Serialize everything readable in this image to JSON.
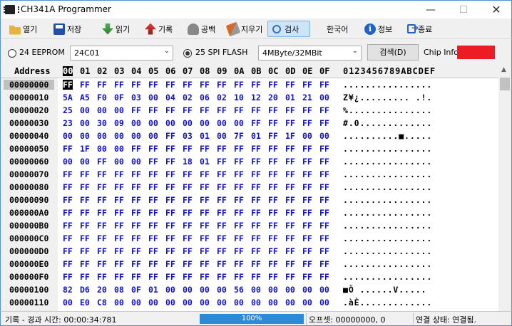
{
  "window": {
    "title": "CH341A Programmer",
    "min": "—",
    "max": "☐",
    "close": "✕"
  },
  "toolbar": [
    {
      "id": "open",
      "label": "열기",
      "icon": "folder-icon"
    },
    {
      "id": "save",
      "label": "저장",
      "icon": "save-icon"
    },
    {
      "id": "read",
      "label": "읽기",
      "icon": "read-icon"
    },
    {
      "id": "write",
      "label": "기록",
      "icon": "write-icon"
    },
    {
      "id": "blank",
      "label": "공백",
      "icon": "blank-check-icon"
    },
    {
      "id": "erase",
      "label": "지우기",
      "icon": "erase-icon"
    },
    {
      "id": "verify",
      "label": "검사",
      "icon": "verify-icon"
    },
    {
      "id": "lang",
      "label": "한국어",
      "icon": ""
    },
    {
      "id": "info",
      "label": "정보",
      "icon": "info-icon"
    },
    {
      "id": "exit",
      "label": "종료",
      "icon": "exit-icon"
    }
  ],
  "chip": {
    "eeprom_label": "24 EEPROM",
    "eeprom_model": "24C01",
    "spi_label": "25 SPI FLASH",
    "spi_selected": true,
    "spi_size": "4MByte/32MBit",
    "detect_label": "검색(D)",
    "chip_info_label": "Chip Info:",
    "chip_info_color": "#ed1c24"
  },
  "hex": {
    "address_header": "Address",
    "columns": [
      "00",
      "01",
      "02",
      "03",
      "04",
      "05",
      "06",
      "07",
      "08",
      "09",
      "0A",
      "0B",
      "0C",
      "0D",
      "0E",
      "0F"
    ],
    "ascii_header": "0123456789ABCDEF",
    "rows": [
      {
        "addr": "00000000",
        "bytes": [
          "FF",
          "FF",
          "FF",
          "FF",
          "FF",
          "FF",
          "FF",
          "FF",
          "FF",
          "FF",
          "FF",
          "FF",
          "FF",
          "FF",
          "FF",
          "FF"
        ],
        "ascii": "................"
      },
      {
        "addr": "00000010",
        "bytes": [
          "5A",
          "A5",
          "F0",
          "0F",
          "03",
          "00",
          "04",
          "02",
          "06",
          "02",
          "10",
          "12",
          "20",
          "01",
          "21",
          "00"
        ],
        "ascii": "Z¥¿......... .!."
      },
      {
        "addr": "00000020",
        "bytes": [
          "25",
          "00",
          "00",
          "00",
          "FF",
          "FF",
          "FF",
          "FF",
          "FF",
          "FF",
          "FF",
          "FF",
          "FF",
          "FF",
          "FF",
          "FF"
        ],
        "ascii": "%..............."
      },
      {
        "addr": "00000030",
        "bytes": [
          "23",
          "00",
          "30",
          "09",
          "00",
          "00",
          "00",
          "00",
          "00",
          "00",
          "00",
          "FF",
          "FF",
          "FF",
          "FF",
          "FF"
        ],
        "ascii": "#.0............."
      },
      {
        "addr": "00000040",
        "bytes": [
          "00",
          "00",
          "00",
          "00",
          "00",
          "00",
          "FF",
          "03",
          "01",
          "00",
          "7F",
          "01",
          "FF",
          "1F",
          "00",
          "00"
        ],
        "ascii": "..........■....."
      },
      {
        "addr": "00000050",
        "bytes": [
          "FF",
          "1F",
          "00",
          "00",
          "FF",
          "FF",
          "FF",
          "FF",
          "FF",
          "FF",
          "FF",
          "FF",
          "FF",
          "FF",
          "FF",
          "FF"
        ],
        "ascii": "................"
      },
      {
        "addr": "00000060",
        "bytes": [
          "00",
          "00",
          "FF",
          "00",
          "00",
          "FF",
          "FF",
          "18",
          "01",
          "FF",
          "FF",
          "FF",
          "FF",
          "FF",
          "FF",
          "FF"
        ],
        "ascii": "................"
      },
      {
        "addr": "00000070",
        "bytes": [
          "FF",
          "FF",
          "FF",
          "FF",
          "FF",
          "FF",
          "FF",
          "FF",
          "FF",
          "FF",
          "FF",
          "FF",
          "FF",
          "FF",
          "FF",
          "FF"
        ],
        "ascii": "................"
      },
      {
        "addr": "00000080",
        "bytes": [
          "FF",
          "FF",
          "FF",
          "FF",
          "FF",
          "FF",
          "FF",
          "FF",
          "FF",
          "FF",
          "FF",
          "FF",
          "FF",
          "FF",
          "FF",
          "FF"
        ],
        "ascii": "................"
      },
      {
        "addr": "00000090",
        "bytes": [
          "FF",
          "FF",
          "FF",
          "FF",
          "FF",
          "FF",
          "FF",
          "FF",
          "FF",
          "FF",
          "FF",
          "FF",
          "FF",
          "FF",
          "FF",
          "FF"
        ],
        "ascii": "................"
      },
      {
        "addr": "000000A0",
        "bytes": [
          "FF",
          "FF",
          "FF",
          "FF",
          "FF",
          "FF",
          "FF",
          "FF",
          "FF",
          "FF",
          "FF",
          "FF",
          "FF",
          "FF",
          "FF",
          "FF"
        ],
        "ascii": "................"
      },
      {
        "addr": "000000B0",
        "bytes": [
          "FF",
          "FF",
          "FF",
          "FF",
          "FF",
          "FF",
          "FF",
          "FF",
          "FF",
          "FF",
          "FF",
          "FF",
          "FF",
          "FF",
          "FF",
          "FF"
        ],
        "ascii": "................"
      },
      {
        "addr": "000000C0",
        "bytes": [
          "FF",
          "FF",
          "FF",
          "FF",
          "FF",
          "FF",
          "FF",
          "FF",
          "FF",
          "FF",
          "FF",
          "FF",
          "FF",
          "FF",
          "FF",
          "FF"
        ],
        "ascii": "................"
      },
      {
        "addr": "000000D0",
        "bytes": [
          "FF",
          "FF",
          "FF",
          "FF",
          "FF",
          "FF",
          "FF",
          "FF",
          "FF",
          "FF",
          "FF",
          "FF",
          "FF",
          "FF",
          "FF",
          "FF"
        ],
        "ascii": "................"
      },
      {
        "addr": "000000E0",
        "bytes": [
          "FF",
          "FF",
          "FF",
          "FF",
          "FF",
          "FF",
          "FF",
          "FF",
          "FF",
          "FF",
          "FF",
          "FF",
          "FF",
          "FF",
          "FF",
          "FF"
        ],
        "ascii": "................"
      },
      {
        "addr": "000000F0",
        "bytes": [
          "FF",
          "FF",
          "FF",
          "FF",
          "FF",
          "FF",
          "FF",
          "FF",
          "FF",
          "FF",
          "FF",
          "FF",
          "FF",
          "FF",
          "FF",
          "FF"
        ],
        "ascii": "................"
      },
      {
        "addr": "00000100",
        "bytes": [
          "82",
          "D6",
          "20",
          "08",
          "0F",
          "01",
          "00",
          "00",
          "00",
          "00",
          "56",
          "00",
          "00",
          "00",
          "00",
          "00"
        ],
        "ascii": "■Ö ......V....."
      },
      {
        "addr": "00000110",
        "bytes": [
          "00",
          "E0",
          "C8",
          "00",
          "00",
          "00",
          "00",
          "00",
          "00",
          "00",
          "00",
          "00",
          "00",
          "00",
          "00",
          "00"
        ],
        "ascii": ".àÈ............."
      }
    ]
  },
  "status": {
    "record_label": "기록 - 경과 시간: 00:00:34:781",
    "progress_text": "100%",
    "progress_value": 100,
    "offset_label": "오프셋: 00000000, 0",
    "connection_label": "연결 상태: 연결됨."
  }
}
